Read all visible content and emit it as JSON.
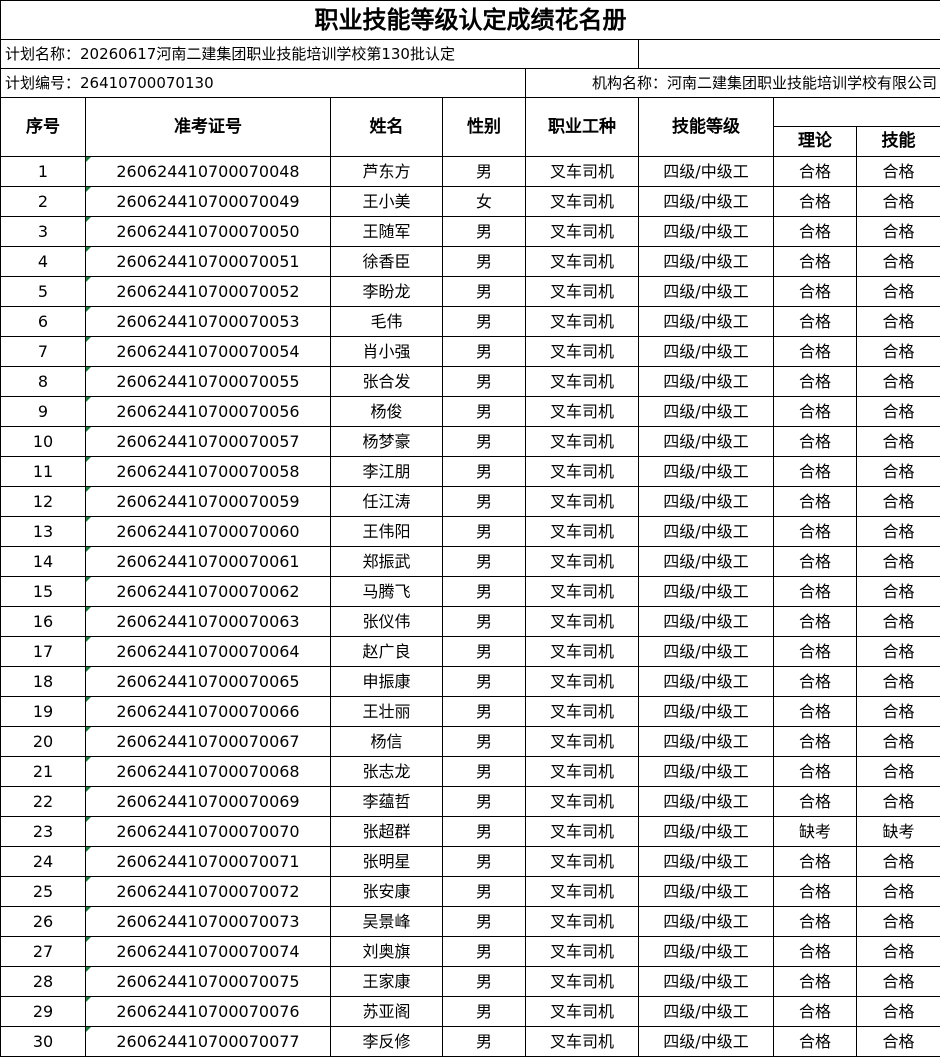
{
  "title": "职业技能等级认定成绩花名册",
  "plan_name": "计划名称：20260617河南二建集团职业技能培训学校第130批认定",
  "plan_no": "计划编号：26410700070130",
  "org_name": "机构名称：河南二建集团职业技能培训学校有限公司",
  "headers": {
    "seq": "序号",
    "exam_no": "准考证号",
    "name": "姓名",
    "gender": "性别",
    "occupation": "职业工种",
    "level": "技能等级",
    "theory": "理论",
    "skill": "技能"
  },
  "rows": [
    {
      "seq": "1",
      "exam_no": "260624410700070048",
      "name": "芦东方",
      "gender": "男",
      "occupation": "叉车司机",
      "level": "四级/中级工",
      "theory": "合格",
      "skill": "合格"
    },
    {
      "seq": "2",
      "exam_no": "260624410700070049",
      "name": "王小美",
      "gender": "女",
      "occupation": "叉车司机",
      "level": "四级/中级工",
      "theory": "合格",
      "skill": "合格"
    },
    {
      "seq": "3",
      "exam_no": "260624410700070050",
      "name": "王随军",
      "gender": "男",
      "occupation": "叉车司机",
      "level": "四级/中级工",
      "theory": "合格",
      "skill": "合格"
    },
    {
      "seq": "4",
      "exam_no": "260624410700070051",
      "name": "徐香臣",
      "gender": "男",
      "occupation": "叉车司机",
      "level": "四级/中级工",
      "theory": "合格",
      "skill": "合格"
    },
    {
      "seq": "5",
      "exam_no": "260624410700070052",
      "name": "李盼龙",
      "gender": "男",
      "occupation": "叉车司机",
      "level": "四级/中级工",
      "theory": "合格",
      "skill": "合格"
    },
    {
      "seq": "6",
      "exam_no": "260624410700070053",
      "name": "毛伟",
      "gender": "男",
      "occupation": "叉车司机",
      "level": "四级/中级工",
      "theory": "合格",
      "skill": "合格"
    },
    {
      "seq": "7",
      "exam_no": "260624410700070054",
      "name": "肖小强",
      "gender": "男",
      "occupation": "叉车司机",
      "level": "四级/中级工",
      "theory": "合格",
      "skill": "合格"
    },
    {
      "seq": "8",
      "exam_no": "260624410700070055",
      "name": "张合发",
      "gender": "男",
      "occupation": "叉车司机",
      "level": "四级/中级工",
      "theory": "合格",
      "skill": "合格"
    },
    {
      "seq": "9",
      "exam_no": "260624410700070056",
      "name": "杨俊",
      "gender": "男",
      "occupation": "叉车司机",
      "level": "四级/中级工",
      "theory": "合格",
      "skill": "合格"
    },
    {
      "seq": "10",
      "exam_no": "260624410700070057",
      "name": "杨梦豪",
      "gender": "男",
      "occupation": "叉车司机",
      "level": "四级/中级工",
      "theory": "合格",
      "skill": "合格"
    },
    {
      "seq": "11",
      "exam_no": "260624410700070058",
      "name": "李江朋",
      "gender": "男",
      "occupation": "叉车司机",
      "level": "四级/中级工",
      "theory": "合格",
      "skill": "合格"
    },
    {
      "seq": "12",
      "exam_no": "260624410700070059",
      "name": "任江涛",
      "gender": "男",
      "occupation": "叉车司机",
      "level": "四级/中级工",
      "theory": "合格",
      "skill": "合格"
    },
    {
      "seq": "13",
      "exam_no": "260624410700070060",
      "name": "王伟阳",
      "gender": "男",
      "occupation": "叉车司机",
      "level": "四级/中级工",
      "theory": "合格",
      "skill": "合格"
    },
    {
      "seq": "14",
      "exam_no": "260624410700070061",
      "name": "郑振武",
      "gender": "男",
      "occupation": "叉车司机",
      "level": "四级/中级工",
      "theory": "合格",
      "skill": "合格"
    },
    {
      "seq": "15",
      "exam_no": "260624410700070062",
      "name": "马腾飞",
      "gender": "男",
      "occupation": "叉车司机",
      "level": "四级/中级工",
      "theory": "合格",
      "skill": "合格"
    },
    {
      "seq": "16",
      "exam_no": "260624410700070063",
      "name": "张仪伟",
      "gender": "男",
      "occupation": "叉车司机",
      "level": "四级/中级工",
      "theory": "合格",
      "skill": "合格"
    },
    {
      "seq": "17",
      "exam_no": "260624410700070064",
      "name": "赵广良",
      "gender": "男",
      "occupation": "叉车司机",
      "level": "四级/中级工",
      "theory": "合格",
      "skill": "合格"
    },
    {
      "seq": "18",
      "exam_no": "260624410700070065",
      "name": "申振康",
      "gender": "男",
      "occupation": "叉车司机",
      "level": "四级/中级工",
      "theory": "合格",
      "skill": "合格"
    },
    {
      "seq": "19",
      "exam_no": "260624410700070066",
      "name": "王壮丽",
      "gender": "男",
      "occupation": "叉车司机",
      "level": "四级/中级工",
      "theory": "合格",
      "skill": "合格"
    },
    {
      "seq": "20",
      "exam_no": "260624410700070067",
      "name": "杨信",
      "gender": "男",
      "occupation": "叉车司机",
      "level": "四级/中级工",
      "theory": "合格",
      "skill": "合格"
    },
    {
      "seq": "21",
      "exam_no": "260624410700070068",
      "name": "张志龙",
      "gender": "男",
      "occupation": "叉车司机",
      "level": "四级/中级工",
      "theory": "合格",
      "skill": "合格"
    },
    {
      "seq": "22",
      "exam_no": "260624410700070069",
      "name": "李蕴哲",
      "gender": "男",
      "occupation": "叉车司机",
      "level": "四级/中级工",
      "theory": "合格",
      "skill": "合格"
    },
    {
      "seq": "23",
      "exam_no": "260624410700070070",
      "name": "张超群",
      "gender": "男",
      "occupation": "叉车司机",
      "level": "四级/中级工",
      "theory": "缺考",
      "skill": "缺考"
    },
    {
      "seq": "24",
      "exam_no": "260624410700070071",
      "name": "张明星",
      "gender": "男",
      "occupation": "叉车司机",
      "level": "四级/中级工",
      "theory": "合格",
      "skill": "合格"
    },
    {
      "seq": "25",
      "exam_no": "260624410700070072",
      "name": "张安康",
      "gender": "男",
      "occupation": "叉车司机",
      "level": "四级/中级工",
      "theory": "合格",
      "skill": "合格"
    },
    {
      "seq": "26",
      "exam_no": "260624410700070073",
      "name": "吴景峰",
      "gender": "男",
      "occupation": "叉车司机",
      "level": "四级/中级工",
      "theory": "合格",
      "skill": "合格"
    },
    {
      "seq": "27",
      "exam_no": "260624410700070074",
      "name": "刘奥旗",
      "gender": "男",
      "occupation": "叉车司机",
      "level": "四级/中级工",
      "theory": "合格",
      "skill": "合格"
    },
    {
      "seq": "28",
      "exam_no": "260624410700070075",
      "name": "王家康",
      "gender": "男",
      "occupation": "叉车司机",
      "level": "四级/中级工",
      "theory": "合格",
      "skill": "合格"
    },
    {
      "seq": "29",
      "exam_no": "260624410700070076",
      "name": "苏亚阁",
      "gender": "男",
      "occupation": "叉车司机",
      "level": "四级/中级工",
      "theory": "合格",
      "skill": "合格"
    },
    {
      "seq": "30",
      "exam_no": "260624410700070077",
      "name": "李反修",
      "gender": "男",
      "occupation": "叉车司机",
      "level": "四级/中级工",
      "theory": "合格",
      "skill": "合格"
    }
  ]
}
